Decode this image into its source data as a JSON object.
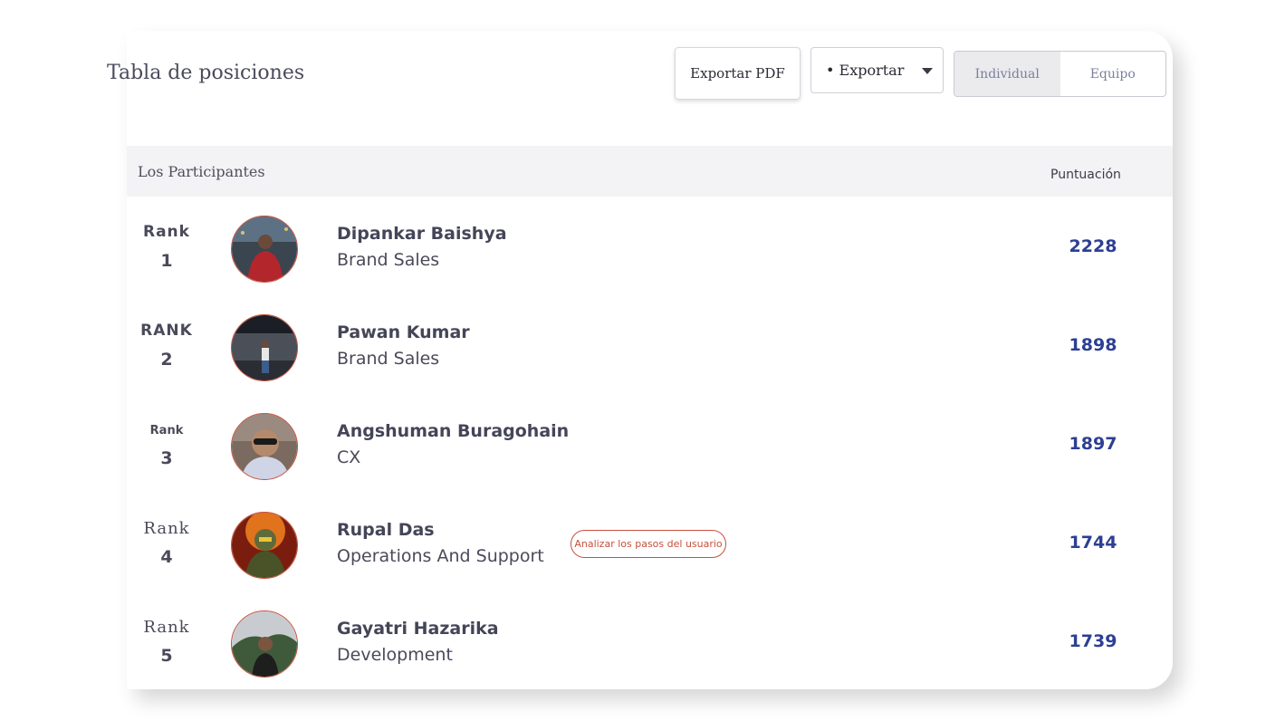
{
  "header": {
    "title": "Tabla de posiciones",
    "export_pdf_label": "Exportar PDF",
    "export_select_value": "• Exportar",
    "toggle": {
      "individual": "Individual",
      "team": "Equipo",
      "active": "Individual"
    }
  },
  "table": {
    "col_participants": "Los Participantes",
    "col_score": "Puntuación",
    "rows": [
      {
        "rank_label": "Rank",
        "rank": "1",
        "name": "Dipankar Baishya",
        "department": "Brand Sales",
        "score": "2228"
      },
      {
        "rank_label": "RANK",
        "rank": "2",
        "name": "Pawan Kumar",
        "department": "Brand Sales",
        "score": "1898"
      },
      {
        "rank_label": "Rank",
        "rank": "3",
        "name": "Angshuman Buragohain",
        "department": "CX",
        "score": "1897"
      },
      {
        "rank_label": "Rank",
        "rank": "4",
        "name": "Rupal Das",
        "department": "Operations And Support",
        "score": "1744",
        "action_label": "Analizar los pasos del usuario"
      },
      {
        "rank_label": "Rank",
        "rank": "5",
        "name": "Gayatri Hazarika",
        "department": "Development",
        "score": "1739"
      }
    ]
  },
  "colors": {
    "score": "#2d3f93",
    "accent": "#c7503c",
    "header_bg": "#f3f3f5",
    "text": "#454558"
  }
}
